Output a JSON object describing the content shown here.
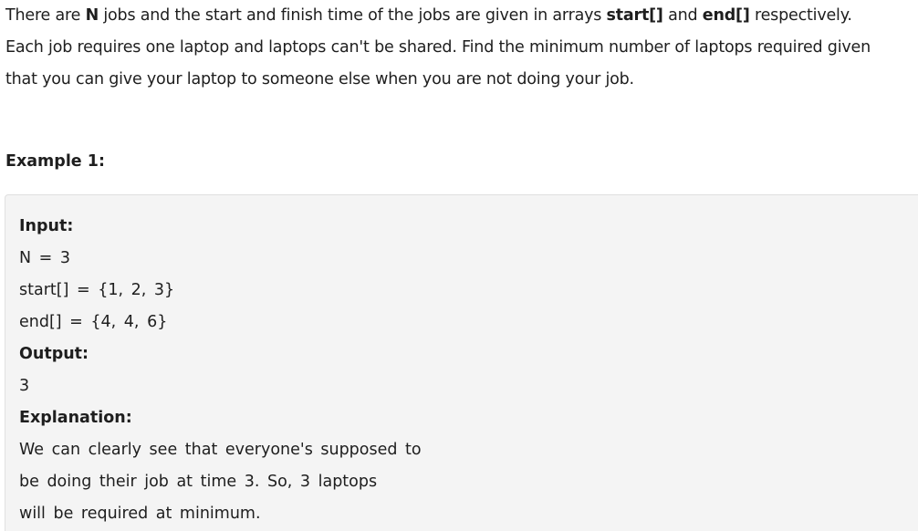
{
  "problem": {
    "line1_a": "There are ",
    "line1_n": "N",
    "line1_b": " jobs and the start and finish time of the jobs are given in arrays ",
    "line1_start": "start[]",
    "line1_and": " and ",
    "line1_end": "end[]",
    "line1_c": " respectively.",
    "line2": "Each job requires one laptop and laptops can't be shared. Find the minimum number of laptops required given",
    "line3": "that you can give your laptop to someone else when you are not doing your job."
  },
  "example": {
    "title": "Example 1:",
    "input_label": "Input:",
    "input_lines": [
      "N = 3",
      "start[] = {1, 2, 3}",
      "end[] = {4, 4, 6}"
    ],
    "output_label": "Output:",
    "output_value": "3",
    "explanation_label": "Explanation:",
    "explanation_lines": [
      "We can clearly see that everyone's supposed to",
      "be doing their job at time 3. So, 3 laptops",
      "will be required at minimum."
    ]
  }
}
